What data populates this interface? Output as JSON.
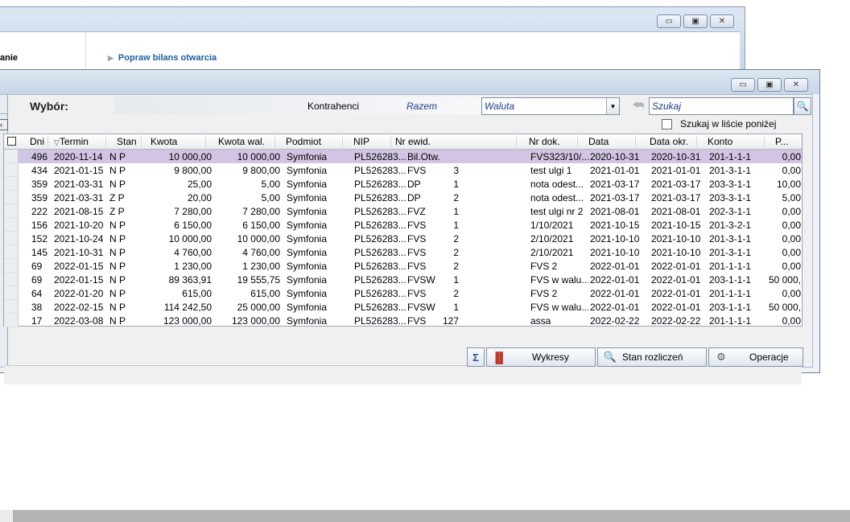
{
  "bg_window": {
    "left_text": "anie",
    "link": "Popraw bilans otwarcia"
  },
  "window_controls": {
    "minimize": "▭",
    "maximize": "▣",
    "close": "✕"
  },
  "toolbar": {
    "title": "Wybór:",
    "kontrahenci": "Kontrahenci",
    "razem": "Razem",
    "waluta_value": "Waluta",
    "search_placeholder": "Szukaj",
    "search_in_list": "Szukaj w liście poniżej"
  },
  "columns": [
    "Dni",
    "Termin",
    "Stan",
    "Kwota",
    "Kwota wal.",
    "Podmiot",
    "NIP",
    "Nr ewid.",
    "Nr dok.",
    "Data",
    "Data okr.",
    "Konto",
    "P..."
  ],
  "rows": [
    {
      "dni": "496",
      "termin": "2020-11-14",
      "stan": "N P",
      "kwota": "10 000,00",
      "kwota_wal": "10 000,00",
      "podmiot": "Symfonia",
      "nip": "PL526283...",
      "ewid_typ": "Bil.Otw.",
      "ewid_nr": "",
      "nr_dok": "FVS323/10/...",
      "data": "2020-10-31",
      "data_okr": "2020-10-31",
      "konto": "201-1-1-1",
      "p": "0,00"
    },
    {
      "dni": "434",
      "termin": "2021-01-15",
      "stan": "N P",
      "kwota": "9 800,00",
      "kwota_wal": "9 800,00",
      "podmiot": "Symfonia",
      "nip": "PL526283...",
      "ewid_typ": "FVS",
      "ewid_nr": "3",
      "nr_dok": "test ulgi 1",
      "data": "2021-01-01",
      "data_okr": "2021-01-01",
      "konto": "201-3-1-1",
      "p": "0,00"
    },
    {
      "dni": "359",
      "termin": "2021-03-31",
      "stan": "N P",
      "kwota": "25,00",
      "kwota_wal": "5,00",
      "podmiot": "Symfonia",
      "nip": "PL526283...",
      "ewid_typ": "DP",
      "ewid_nr": "1",
      "nr_dok": "nota odest...",
      "data": "2021-03-17",
      "data_okr": "2021-03-17",
      "konto": "203-3-1-1",
      "p": "10,00"
    },
    {
      "dni": "359",
      "termin": "2021-03-31",
      "stan": "Z P",
      "kwota": "20,00",
      "kwota_wal": "5,00",
      "podmiot": "Symfonia",
      "nip": "PL526283...",
      "ewid_typ": "DP",
      "ewid_nr": "2",
      "nr_dok": "nota odest...",
      "data": "2021-03-17",
      "data_okr": "2021-03-17",
      "konto": "203-3-1-1",
      "p": "5,00"
    },
    {
      "dni": "222",
      "termin": "2021-08-15",
      "stan": "Z P",
      "kwota": "7 280,00",
      "kwota_wal": "7 280,00",
      "podmiot": "Symfonia",
      "nip": "PL526283...",
      "ewid_typ": "FVZ",
      "ewid_nr": "1",
      "nr_dok": "test ulgi nr 2",
      "data": "2021-08-01",
      "data_okr": "2021-08-01",
      "konto": "202-3-1-1",
      "p": "0,00"
    },
    {
      "dni": "156",
      "termin": "2021-10-20",
      "stan": "N P",
      "kwota": "6 150,00",
      "kwota_wal": "6 150,00",
      "podmiot": "Symfonia",
      "nip": "PL526283...",
      "ewid_typ": "FVS",
      "ewid_nr": "1",
      "nr_dok": "1/10/2021",
      "data": "2021-10-15",
      "data_okr": "2021-10-15",
      "konto": "201-3-2-1",
      "p": "0,00"
    },
    {
      "dni": "152",
      "termin": "2021-10-24",
      "stan": "N P",
      "kwota": "10 000,00",
      "kwota_wal": "10 000,00",
      "podmiot": "Symfonia",
      "nip": "PL526283...",
      "ewid_typ": "FVS",
      "ewid_nr": "2",
      "nr_dok": "2/10/2021",
      "data": "2021-10-10",
      "data_okr": "2021-10-10",
      "konto": "201-3-1-1",
      "p": "0,00"
    },
    {
      "dni": "145",
      "termin": "2021-10-31",
      "stan": "N P",
      "kwota": "4 760,00",
      "kwota_wal": "4 760,00",
      "podmiot": "Symfonia",
      "nip": "PL526283...",
      "ewid_typ": "FVS",
      "ewid_nr": "2",
      "nr_dok": "2/10/2021",
      "data": "2021-10-10",
      "data_okr": "2021-10-10",
      "konto": "201-3-1-1",
      "p": "0,00"
    },
    {
      "dni": "69",
      "termin": "2022-01-15",
      "stan": "N P",
      "kwota": "1 230,00",
      "kwota_wal": "1 230,00",
      "podmiot": "Symfonia",
      "nip": "PL526283...",
      "ewid_typ": "FVS",
      "ewid_nr": "2",
      "nr_dok": "FVS 2",
      "data": "2022-01-01",
      "data_okr": "2022-01-01",
      "konto": "201-1-1-1",
      "p": "0,00"
    },
    {
      "dni": "69",
      "termin": "2022-01-15",
      "stan": "N P",
      "kwota": "89 363,91",
      "kwota_wal": "19 555,75",
      "podmiot": "Symfonia",
      "nip": "PL526283...",
      "ewid_typ": "FVSW",
      "ewid_nr": "1",
      "nr_dok": "FVS w walu...",
      "data": "2022-01-01",
      "data_okr": "2022-01-01",
      "konto": "203-1-1-1",
      "p": "50 000,"
    },
    {
      "dni": "64",
      "termin": "2022-01-20",
      "stan": "N P",
      "kwota": "615,00",
      "kwota_wal": "615,00",
      "podmiot": "Symfonia",
      "nip": "PL526283...",
      "ewid_typ": "FVS",
      "ewid_nr": "2",
      "nr_dok": "FVS 2",
      "data": "2022-01-01",
      "data_okr": "2022-01-01",
      "konto": "201-1-1-1",
      "p": "0,00"
    },
    {
      "dni": "38",
      "termin": "2022-02-15",
      "stan": "N P",
      "kwota": "114 242,50",
      "kwota_wal": "25 000,00",
      "podmiot": "Symfonia",
      "nip": "PL526283...",
      "ewid_typ": "FVSW",
      "ewid_nr": "1",
      "nr_dok": "FVS w walu...",
      "data": "2022-01-01",
      "data_okr": "2022-01-01",
      "konto": "203-1-1-1",
      "p": "50 000,"
    },
    {
      "dni": "17",
      "termin": "2022-03-08",
      "stan": "N P",
      "kwota": "123 000,00",
      "kwota_wal": "123 000,00",
      "podmiot": "Symfonia",
      "nip": "PL526283...",
      "ewid_typ": "FVS",
      "ewid_nr": "127",
      "nr_dok": "assa",
      "data": "2022-02-22",
      "data_okr": "2022-02-22",
      "konto": "201-1-1-1",
      "p": "0,00"
    }
  ],
  "bottom_buttons": {
    "sum_icon": "Σ",
    "wykresy": "Wykresy",
    "stan_rozliczen": "Stan rozliczeń",
    "operacje": "Operacje"
  },
  "colors": {
    "selected_row": "#d2c4e3",
    "link": "#1b5fa5",
    "italic_field": "#1f3c88"
  }
}
